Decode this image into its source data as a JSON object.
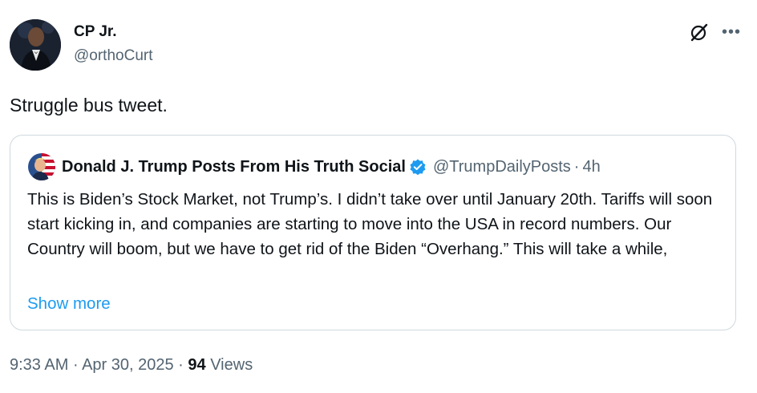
{
  "tweet": {
    "author_name": "CP Jr.",
    "author_handle": "@orthoCurt",
    "text": "Struggle bus tweet.",
    "time": "9:33 AM",
    "date": "Apr 30, 2025",
    "separator": "·",
    "views_count": "94",
    "views_label": "Views"
  },
  "quote": {
    "name": "Donald J. Trump Posts From His Truth Social",
    "handle": "@TrumpDailyPosts",
    "separator": "·",
    "time": "4h",
    "body": "This is Biden’s Stock Market, not Trump’s. I didn’t take over until January 20th. Tariffs will soon start kicking in, and companies are starting to move into the USA in record numbers. Our Country will boom, but we have to get rid of the Biden “Overhang.” This will take a while,",
    "show_more": "Show more"
  },
  "icons": {
    "grok": "grok-icon",
    "more": "more-options-icon",
    "verified": "verified-badge-icon"
  },
  "colors": {
    "accent": "#1d9bf0",
    "secondary_text": "#536471",
    "border": "#cfd9de"
  }
}
